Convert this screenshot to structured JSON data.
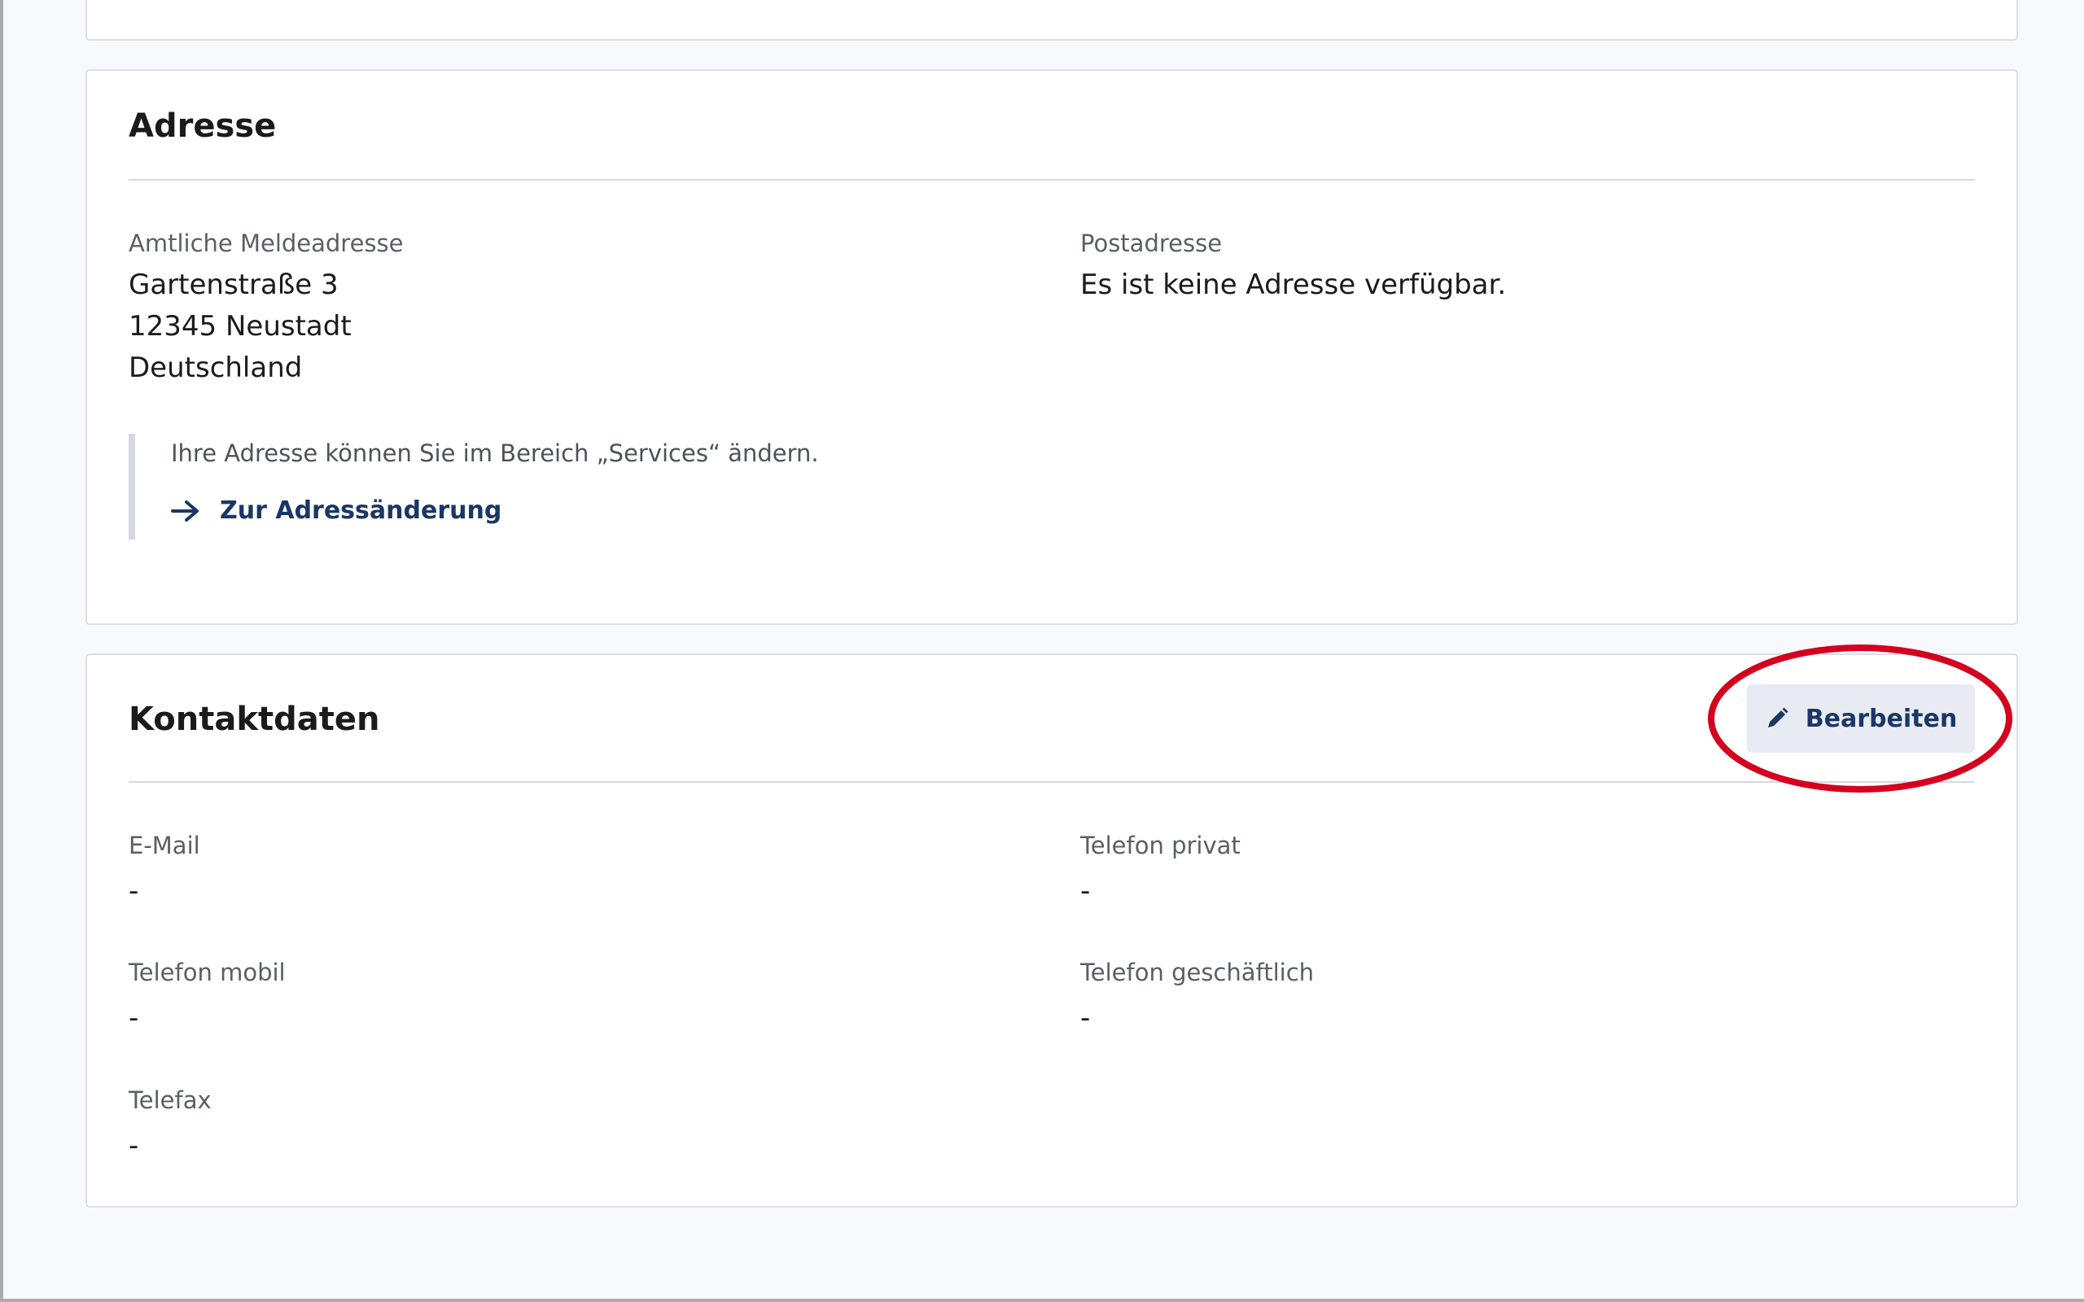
{
  "address_section": {
    "title": "Adresse",
    "registered_label": "Amtliche Meldeadresse",
    "registered_lines": [
      "Gartenstraße 3",
      "12345 Neustadt",
      "Deutschland"
    ],
    "postal_label": "Postadresse",
    "postal_value": "Es ist keine Adresse verfügbar.",
    "hint_text": "Ihre Adresse können Sie im Bereich „Services“ ändern.",
    "link_label": "Zur Adressänderung",
    "link_icon": "arrow-right-icon"
  },
  "contact_section": {
    "title": "Kontaktdaten",
    "edit_label": "Bearbeiten",
    "edit_icon": "pencil-icon",
    "fields": [
      {
        "label": "E-Mail",
        "value": "-"
      },
      {
        "label": "Telefon privat",
        "value": "-"
      },
      {
        "label": "Telefon mobil",
        "value": "-"
      },
      {
        "label": "Telefon geschäftlich",
        "value": "-"
      },
      {
        "label": "Telefax",
        "value": "-"
      }
    ]
  },
  "colors": {
    "link": "#1a3765",
    "button_bg": "#e8ebf2",
    "highlight": "#d4001e",
    "page_bg": "#f8f9fc"
  }
}
